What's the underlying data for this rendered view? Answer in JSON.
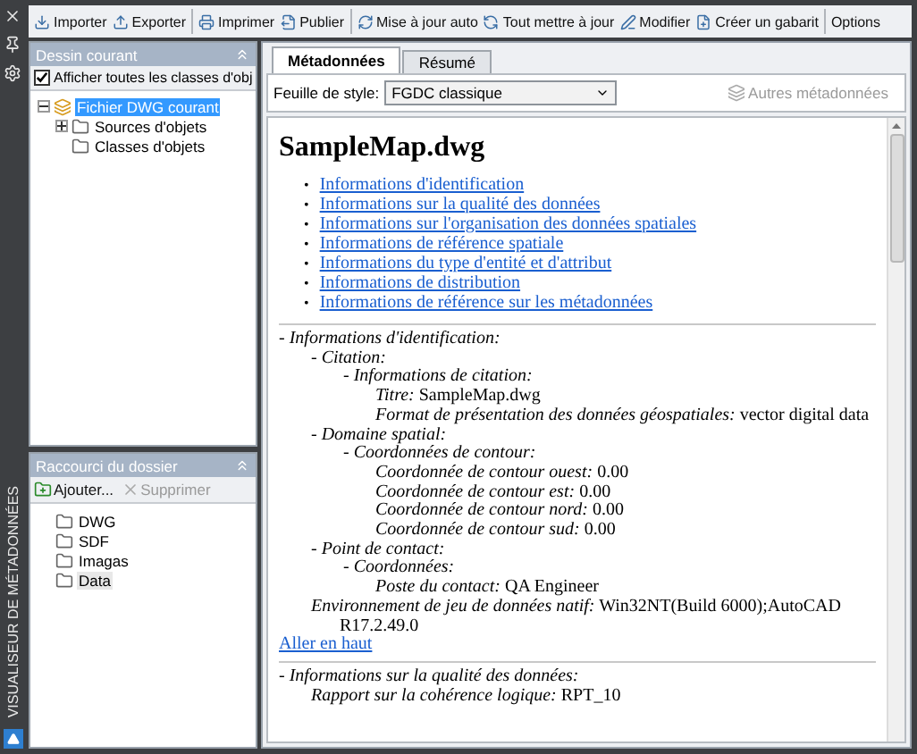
{
  "side_strip": {
    "title": "VISUALISEUR DE MÉTADONNÉES"
  },
  "toolbar": {
    "groups": [
      [
        {
          "label": "Importer"
        },
        {
          "label": "Exporter"
        }
      ],
      [
        {
          "label": "Imprimer"
        },
        {
          "label": "Publier"
        }
      ],
      [
        {
          "label": "Mise à jour auto"
        },
        {
          "label": "Tout mettre à jour"
        },
        {
          "label": "Modifier"
        },
        {
          "label": "Créer un gabarit"
        }
      ],
      [
        {
          "label": "Options"
        }
      ]
    ]
  },
  "current_drawing": {
    "title": "Dessin courant",
    "show_all": {
      "label": "Afficher toutes les classes d'obj",
      "checked": true
    },
    "tree": [
      {
        "label": "Fichier DWG courant",
        "selected": true,
        "expanded": true,
        "children": [
          {
            "label": "Sources d'objets",
            "selected": false,
            "expanded": false
          },
          {
            "label": "Classes d'objets",
            "selected": false
          }
        ]
      }
    ]
  },
  "folder_shortcuts": {
    "title": "Raccourci du dossier",
    "add": {
      "label": "Ajouter...",
      "disabled": false
    },
    "remove": {
      "label": "Supprimer",
      "disabled": true
    },
    "folders": [
      {
        "label": "DWG",
        "selected": false
      },
      {
        "label": "SDF",
        "selected": false
      },
      {
        "label": "Imagas",
        "selected": false
      },
      {
        "label": "Data",
        "selected": true
      }
    ]
  },
  "tabs": [
    {
      "label": "Métadonnées",
      "selected": true
    },
    {
      "label": "Résumé",
      "selected": false
    }
  ],
  "stylesheet": {
    "label": "Feuille de style:",
    "value": "FGDC classique"
  },
  "more_metadata": {
    "label": "Autres métadonnées",
    "disabled": true
  },
  "document": {
    "title": "SampleMap.dwg",
    "bullet": "•",
    "links": [
      "Informations d'identification",
      "Informations sur la qualité des données",
      "Informations sur l'organisation des données spatiales",
      "Informations de référence spatiale",
      "Informations du type d'entité et d'attribut",
      "Informations de distribution",
      "Informations de référence sur les métadonnées"
    ],
    "sections": [
      {
        "entries": [
          {
            "label": "- Informations d'identification:",
            "children": [
              {
                "label": "- Citation:",
                "children": [
                  {
                    "label": "- Informations de citation:",
                    "children": [
                      {
                        "label": "Titre:",
                        "value": "SampleMap.dwg"
                      },
                      {
                        "label": "Format de présentation des données géospatiales:",
                        "value": "vector digital data"
                      }
                    ]
                  }
                ]
              },
              {
                "label": "- Domaine spatial:",
                "children": [
                  {
                    "label": "- Coordonnées de contour:",
                    "children": [
                      {
                        "label": "Coordonnée de contour ouest:",
                        "value": "0.00"
                      },
                      {
                        "label": "Coordonnée de contour est:",
                        "value": "0.00"
                      },
                      {
                        "label": "Coordonnée de contour nord:",
                        "value": "0.00"
                      },
                      {
                        "label": "Coordonnée de contour sud:",
                        "value": "0.00"
                      }
                    ]
                  }
                ]
              },
              {
                "label": "- Point de contact:",
                "children": [
                  {
                    "label": "- Coordonnées:",
                    "children": [
                      {
                        "label": "Poste du contact:",
                        "value": "QA Engineer"
                      }
                    ]
                  }
                ]
              },
              {
                "label": "Environnement de jeu de données natif:",
                "value": "Win32NT(Build 6000);AutoCAD R17.2.49.0"
              }
            ]
          }
        ],
        "back_link": "Aller en haut"
      },
      {
        "entries": [
          {
            "label": "- Informations sur la qualité des données:",
            "children": [
              {
                "label": "Rapport sur la cohérence logique:",
                "value": "RPT_10"
              }
            ]
          }
        ]
      }
    ]
  }
}
